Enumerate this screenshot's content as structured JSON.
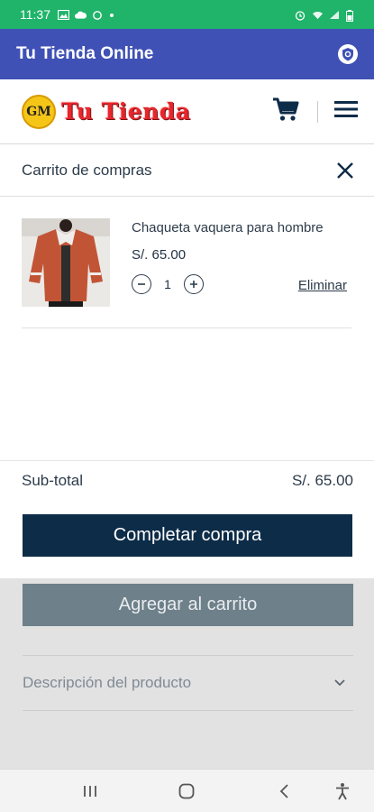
{
  "status_bar": {
    "time": "11:37",
    "left_icons": [
      "image-icon",
      "cloud-icon",
      "sync-icon",
      "dot-icon"
    ],
    "right_icons": [
      "alarm-icon",
      "wifi-icon",
      "signal-icon",
      "battery-icon"
    ]
  },
  "app_bar": {
    "title": "Tu Tienda Online",
    "icon": "shield-icon"
  },
  "site_header": {
    "logo_badge": "GM",
    "logo_text": "Tu Tienda",
    "cart_icon": "cart-icon",
    "menu_icon": "hamburger-icon"
  },
  "cart": {
    "title": "Carrito de compras",
    "close_icon": "close-icon",
    "items": [
      {
        "name": "Chaqueta vaquera para hombre",
        "price": "S/. 65.00",
        "quantity": "1",
        "remove_label": "Eliminar",
        "decrease_icon": "minus-icon",
        "increase_icon": "plus-icon"
      }
    ],
    "subtotal_label": "Sub-total",
    "subtotal_value": "S/. 65.00",
    "checkout_label": "Completar compra"
  },
  "product_page": {
    "add_to_cart_label": "Agregar al carrito",
    "description_label": "Descripción del producto",
    "description_icon": "chevron-down-icon"
  },
  "nav_bar": {
    "icons": [
      "recent-apps-icon",
      "home-icon",
      "back-icon",
      "accessibility-icon"
    ]
  },
  "colors": {
    "status_bar": "#20b36a",
    "app_bar": "#3f51b5",
    "primary_button": "#0d2c48",
    "secondary_button": "#6e8089",
    "logo_red": "#e8262c"
  }
}
